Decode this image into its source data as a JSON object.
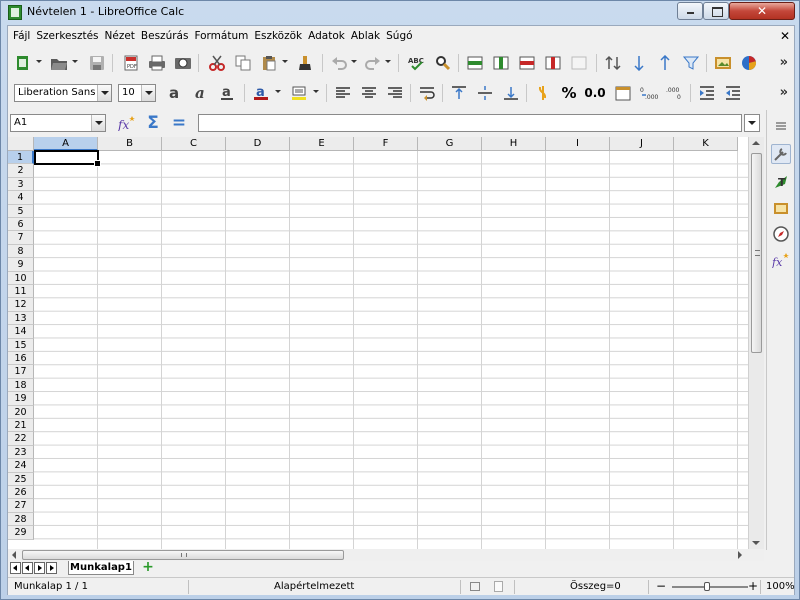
{
  "window": {
    "title": "Névtelen 1 - LibreOffice Calc",
    "close_glyph": "✕",
    "doc_close_glyph": "✕"
  },
  "menu": [
    "Fájl",
    "Szerkesztés",
    "Nézet",
    "Beszúrás",
    "Formátum",
    "Eszközök",
    "Adatok",
    "Ablak",
    "Súgó"
  ],
  "toolbar": {
    "font_name": "Liberation Sans",
    "font_size": "10",
    "more_glyph": "»",
    "percent_glyph": "%",
    "number_glyph": "0.0"
  },
  "formula_bar": {
    "cell_ref": "A1",
    "formula": "",
    "sum_glyph": "Σ",
    "equals_glyph": "="
  },
  "columns": [
    "A",
    "B",
    "C",
    "D",
    "E",
    "F",
    "G",
    "H",
    "I",
    "J",
    "K"
  ],
  "rows": [
    "1",
    "2",
    "3",
    "4",
    "5",
    "6",
    "7",
    "8",
    "9",
    "10",
    "11",
    "12",
    "13",
    "14",
    "15",
    "16",
    "17",
    "18",
    "19",
    "20",
    "21",
    "22",
    "23",
    "24",
    "25",
    "26",
    "27",
    "28",
    "29"
  ],
  "selected_cell": "A1",
  "sheet_tabs": [
    {
      "label": "Munkalap1",
      "active": true
    }
  ],
  "add_tab_glyph": "+",
  "status_bar": {
    "sheet_info": "Munkalap 1 / 1",
    "page_style": "Alapértelmezett",
    "sum": "Összeg=0",
    "zoom": "100%",
    "zoom_minus": "−",
    "zoom_plus": "+"
  },
  "colors": {
    "selection": "#b8d0ec",
    "accent": "#3a78c8"
  }
}
